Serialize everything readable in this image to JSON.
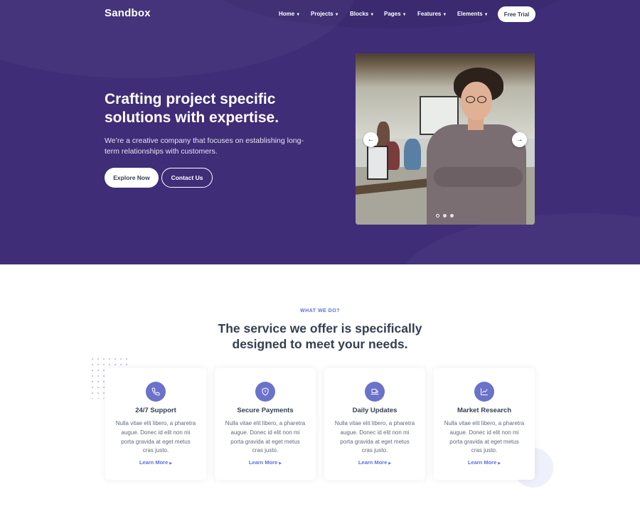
{
  "brand": "Sandbox",
  "nav": {
    "items": [
      "Home",
      "Projects",
      "Blocks",
      "Pages",
      "Features",
      "Elements"
    ],
    "cta": "Free Trial"
  },
  "hero": {
    "title": "Crafting project specific solutions with expertise.",
    "subtitle": "We’re a creative company that focuses on establishing long-term relationships with customers.",
    "primary_button": "Explore Now",
    "secondary_button": "Contact Us",
    "carousel": {
      "slides": 3,
      "active_slide": 1
    }
  },
  "services": {
    "kicker": "WHAT WE DO?",
    "title": "The service we offer is specifically designed to meet your needs.",
    "cards": [
      {
        "icon": "phone-icon",
        "title": "24/7 Support",
        "text": "Nulla vitae elit libero, a pharetra augue. Donec id elit non mi porta gravida at eget metus cras justo.",
        "link": "Learn More"
      },
      {
        "icon": "shield-icon",
        "title": "Secure Payments",
        "text": "Nulla vitae elit libero, a pharetra augue. Donec id elit non mi porta gravida at eget metus cras justo.",
        "link": "Learn More"
      },
      {
        "icon": "laptop-icon",
        "title": "Daily Updates",
        "text": "Nulla vitae elit libero, a pharetra augue. Donec id elit non mi porta gravida at eget metus cras justo.",
        "link": "Learn More"
      },
      {
        "icon": "chart-icon",
        "title": "Market Research",
        "text": "Nulla vitae elit libero, a pharetra augue. Donec id elit non mi porta gravida at eget metus cras justo.",
        "link": "Learn More"
      }
    ]
  },
  "colors": {
    "hero_bg": "#3f2d77",
    "accent": "#5b6ee8",
    "icon_bg": "#6a72c9"
  }
}
